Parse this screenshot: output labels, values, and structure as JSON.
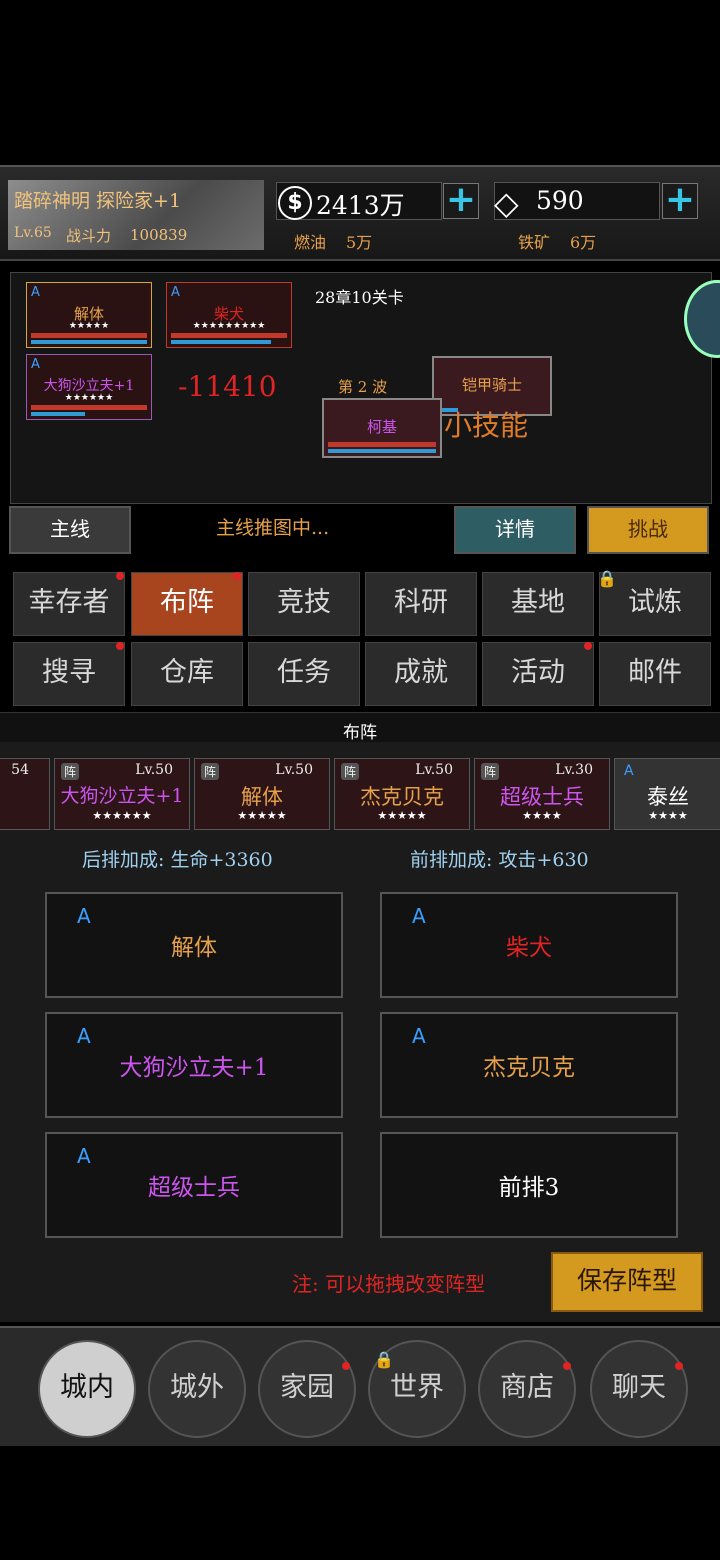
{
  "player": {
    "name": "踏碎神明 探险家+1",
    "level": "Lv.65",
    "power_label": "战斗力",
    "power_value": "100839"
  },
  "resources": {
    "coin_symbol": "$",
    "coin": "2413万",
    "gem": "590",
    "fuel_label": "燃油",
    "fuel": "5万",
    "iron_label": "铁矿",
    "iron": "6万"
  },
  "battle": {
    "stage": "28章10关卡",
    "damage": "-11410",
    "wave": "第 2 波",
    "skill_text": "小技能",
    "allies": [
      {
        "rank": "A",
        "name": "解体",
        "stars": "★★★★★"
      },
      {
        "rank": "A",
        "name": "柴犬",
        "stars": "★★★★★★★★★"
      },
      {
        "rank": "A",
        "name": "大狗沙立夫+1",
        "stars": "★★★★★★"
      }
    ],
    "enemies": [
      {
        "name": "铠甲骑士"
      },
      {
        "name": "柯基"
      }
    ]
  },
  "actions": {
    "main": "主线",
    "progress": "主线推图中...",
    "detail": "详情",
    "challenge": "挑战"
  },
  "menu": [
    {
      "label": "幸存者",
      "dot": true
    },
    {
      "label": "布阵",
      "dot": true,
      "active": true
    },
    {
      "label": "竞技"
    },
    {
      "label": "科研"
    },
    {
      "label": "基地"
    },
    {
      "label": "试炼",
      "locked": true
    },
    {
      "label": "搜寻",
      "dot": true
    },
    {
      "label": "仓库"
    },
    {
      "label": "任务"
    },
    {
      "label": "成就"
    },
    {
      "label": "活动",
      "dot": true
    },
    {
      "label": "邮件"
    }
  ],
  "formation": {
    "title": "布阵",
    "cut_lv": "54",
    "roster": [
      {
        "tag": "阵",
        "level": "Lv.50",
        "name": "大狗沙立夫+1",
        "stars": "★★★★★★"
      },
      {
        "tag": "阵",
        "level": "Lv.50",
        "name": "解体",
        "stars": "★★★★★"
      },
      {
        "tag": "阵",
        "level": "Lv.50",
        "name": "杰克贝克",
        "stars": "★★★★★"
      },
      {
        "tag": "阵",
        "level": "Lv.30",
        "name": "超级士兵",
        "stars": "★★★★"
      },
      {
        "tag": "A",
        "level": "",
        "name": "泰丝",
        "stars": "★★★★"
      }
    ],
    "back_bonus": "后排加成: 生命+3360",
    "front_bonus": "前排加成: 攻击+630",
    "slots": [
      {
        "rank": "A",
        "name": "解体"
      },
      {
        "rank": "A",
        "name": "柴犬"
      },
      {
        "rank": "A",
        "name": "大狗沙立夫+1"
      },
      {
        "rank": "A",
        "name": "杰克贝克"
      },
      {
        "rank": "A",
        "name": "超级士兵"
      },
      {
        "rank": "",
        "name": "前排3"
      }
    ],
    "note": "注: 可以拖拽改变阵型",
    "save": "保存阵型"
  },
  "nav": [
    {
      "label": "城内",
      "active": true
    },
    {
      "label": "城外"
    },
    {
      "label": "家园",
      "dot": true
    },
    {
      "label": "世界",
      "locked": true
    },
    {
      "label": "商店",
      "dot": true
    },
    {
      "label": "聊天",
      "dot": true
    }
  ],
  "colors": {
    "accent_gold": "#d49a1f",
    "rank_blue": "#3aa0ff",
    "hp_red": "#c0392b",
    "active_tab": "#a8451e"
  }
}
